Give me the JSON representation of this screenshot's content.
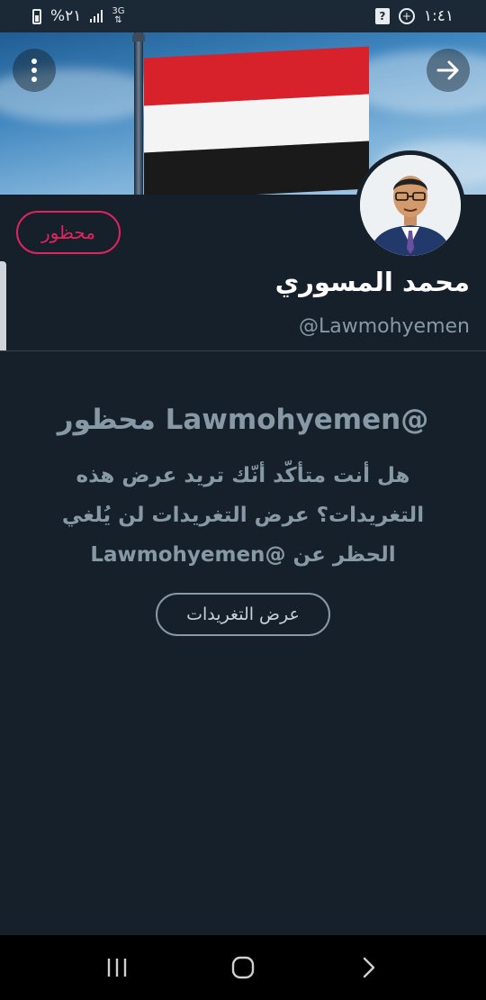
{
  "status_bar": {
    "time": "١:٤١",
    "battery": "%٢١",
    "network": "3G",
    "icons": [
      "battery-icon",
      "signal-icon",
      "data-icon",
      "unknown-app-icon",
      "location-icon"
    ]
  },
  "header": {
    "back_icon": "arrow-right-icon",
    "menu_icon": "more-vertical-icon"
  },
  "profile": {
    "blocked_label": "محظور",
    "name": "محمد المسوري",
    "handle": "@Lawmohyemen"
  },
  "blocked_notice": {
    "title": "@Lawmohyemen محظور",
    "body": "هل أنت متأكّد أنّك تريد عرض هذه التغريدات؟ عرض التغريدات لن يُلغي الحظر عن @Lawmohyemen",
    "button": "عرض التغريدات"
  },
  "nav": {
    "icons": [
      "recents-icon",
      "home-icon",
      "back-icon"
    ]
  },
  "colors": {
    "background": "#15202b",
    "accent_red": "#e0245e",
    "muted": "#8899a6"
  }
}
